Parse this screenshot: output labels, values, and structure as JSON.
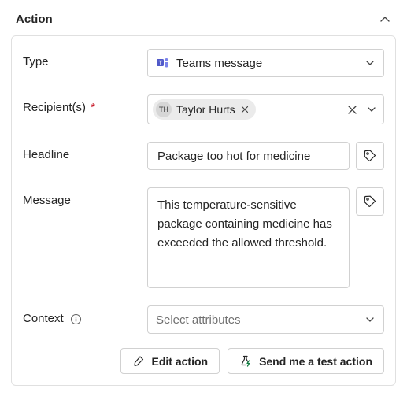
{
  "header": {
    "title": "Action"
  },
  "form": {
    "type": {
      "label": "Type",
      "value": "Teams message"
    },
    "recipients": {
      "label": "Recipient(s)",
      "required": "*",
      "chip": {
        "initials": "TH",
        "name": "Taylor Hurts"
      }
    },
    "headline": {
      "label": "Headline",
      "value": "Package too hot for medicine"
    },
    "message": {
      "label": "Message",
      "value": "This temperature-sensitive package containing medicine has exceeded the allowed threshold."
    },
    "context": {
      "label": "Context",
      "placeholder": "Select attributes"
    }
  },
  "footer": {
    "edit": "Edit action",
    "send_test": "Send me a test action"
  }
}
